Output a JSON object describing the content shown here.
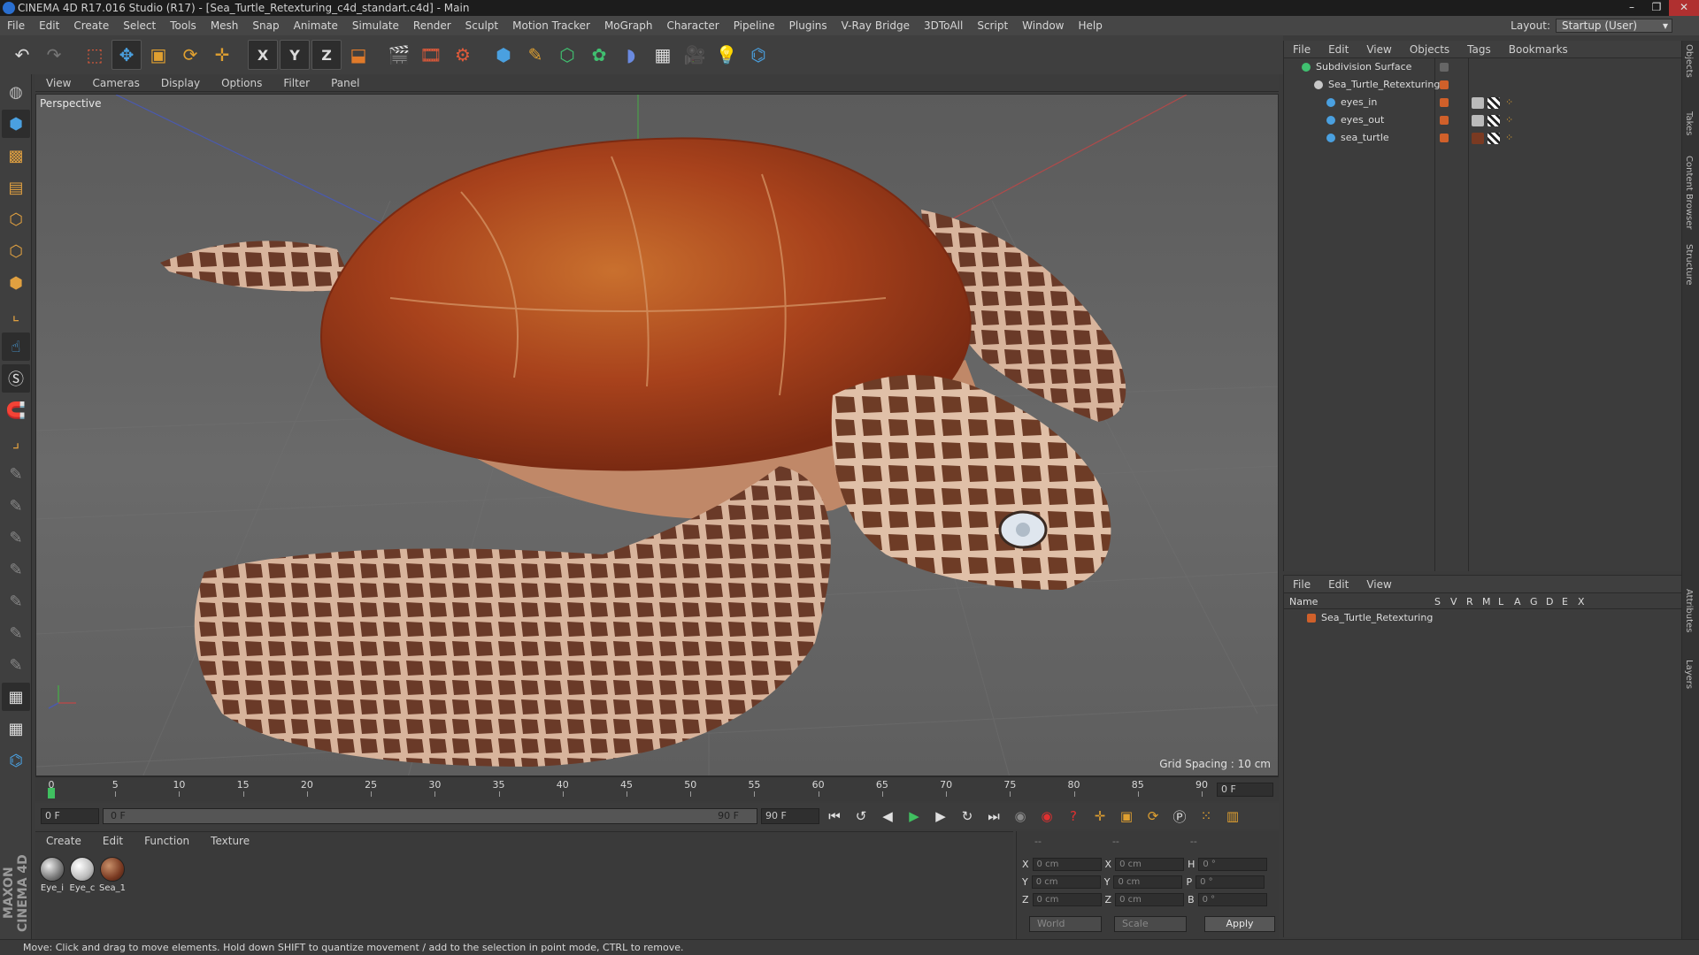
{
  "window": {
    "title": "CINEMA 4D R17.016 Studio (R17) - [Sea_Turtle_Retexturing_c4d_standart.c4d] - Main",
    "controls": [
      "–",
      "❐",
      "✕"
    ]
  },
  "menubar": {
    "items": [
      "File",
      "Edit",
      "Create",
      "Select",
      "Tools",
      "Mesh",
      "Snap",
      "Animate",
      "Simulate",
      "Render",
      "Sculpt",
      "Motion Tracker",
      "MoGraph",
      "Character",
      "Pipeline",
      "Plugins",
      "V-Ray Bridge",
      "3DToAll",
      "Script",
      "Window",
      "Help"
    ],
    "layout_label": "Layout:",
    "layout_value": "Startup (User)"
  },
  "toolbar": {
    "icons": [
      "undo-icon",
      "redo-icon",
      "live-selection-icon",
      "move-icon",
      "scale-icon",
      "rotate-icon",
      "recent-tool-icon",
      "x-axis-icon",
      "y-axis-icon",
      "z-axis-icon",
      "coordinate-system-icon",
      "render-view-icon",
      "render-picture-viewer-icon",
      "edit-render-settings-icon",
      "cube-icon",
      "pen-spline-icon",
      "subdivision-icon",
      "array-icon",
      "deformer-icon",
      "floor-icon",
      "camera-icon",
      "light-icon",
      "python-icon"
    ],
    "axis_x": "X",
    "axis_y": "Y",
    "axis_z": "Z"
  },
  "viewport": {
    "menu": [
      "View",
      "Cameras",
      "Display",
      "Options",
      "Filter",
      "Panel"
    ],
    "label": "Perspective",
    "grid_spacing": "Grid Spacing : 10 cm"
  },
  "timeline": {
    "ticks": [
      "0",
      "5",
      "10",
      "15",
      "20",
      "25",
      "30",
      "35",
      "40",
      "45",
      "50",
      "55",
      "60",
      "65",
      "70",
      "75",
      "80",
      "85",
      "90"
    ],
    "current_frame": "0 F"
  },
  "playbar": {
    "start": "0 F",
    "range_start": "0 F",
    "range_end": "90 F",
    "end": "90 F"
  },
  "materials": {
    "menu": [
      "Create",
      "Edit",
      "Function",
      "Texture"
    ],
    "items": [
      {
        "label": "Eye_i",
        "color": "#9a9a9a"
      },
      {
        "label": "Eye_c",
        "color": "#cfcfcf"
      },
      {
        "label": "Sea_1",
        "color": "#7a3a22"
      }
    ]
  },
  "coordinates": {
    "headers": [
      "--",
      "--",
      "--"
    ],
    "rows": [
      {
        "a": "X",
        "av": "0 cm",
        "b": "X",
        "bv": "0 cm",
        "c": "H",
        "cv": "0 °"
      },
      {
        "a": "Y",
        "av": "0 cm",
        "b": "Y",
        "bv": "0 cm",
        "c": "P",
        "cv": "0 °"
      },
      {
        "a": "Z",
        "av": "0 cm",
        "b": "Z",
        "bv": "0 cm",
        "c": "B",
        "cv": "0 °"
      }
    ],
    "mode1": "World",
    "mode2": "Scale",
    "apply": "Apply"
  },
  "objects": {
    "menu": [
      "File",
      "Edit",
      "View",
      "Objects",
      "Tags",
      "Bookmarks"
    ],
    "items": [
      {
        "name": "Subdivision Surface",
        "indent": 0
      },
      {
        "name": "Sea_Turtle_Retexturing",
        "indent": 1
      },
      {
        "name": "eyes_in",
        "indent": 2
      },
      {
        "name": "eyes_out",
        "indent": 2
      },
      {
        "name": "sea_turtle",
        "indent": 2
      }
    ]
  },
  "layers": {
    "menu": [
      "File",
      "Edit",
      "View"
    ],
    "header_name": "Name",
    "columns": [
      "S",
      "V",
      "R",
      "M",
      "L",
      "A",
      "G",
      "D",
      "E",
      "X"
    ],
    "items": [
      {
        "name": "Sea_Turtle_Retexturing",
        "color": "#d0602a"
      }
    ]
  },
  "dock": [
    "Objects",
    "Takes",
    "Content Browser",
    "Structure",
    "Attributes",
    "Layers"
  ],
  "logo": {
    "line1": "MAXON",
    "line2": "CINEMA 4D"
  },
  "status": "Move: Click and drag to move elements. Hold down SHIFT to quantize movement / add to the selection in point mode, CTRL to remove.",
  "colors": {
    "accent": "#e08a2a",
    "object_orange": "#d0602a",
    "shell": "#a8421c",
    "skin": "#8a5a44"
  }
}
